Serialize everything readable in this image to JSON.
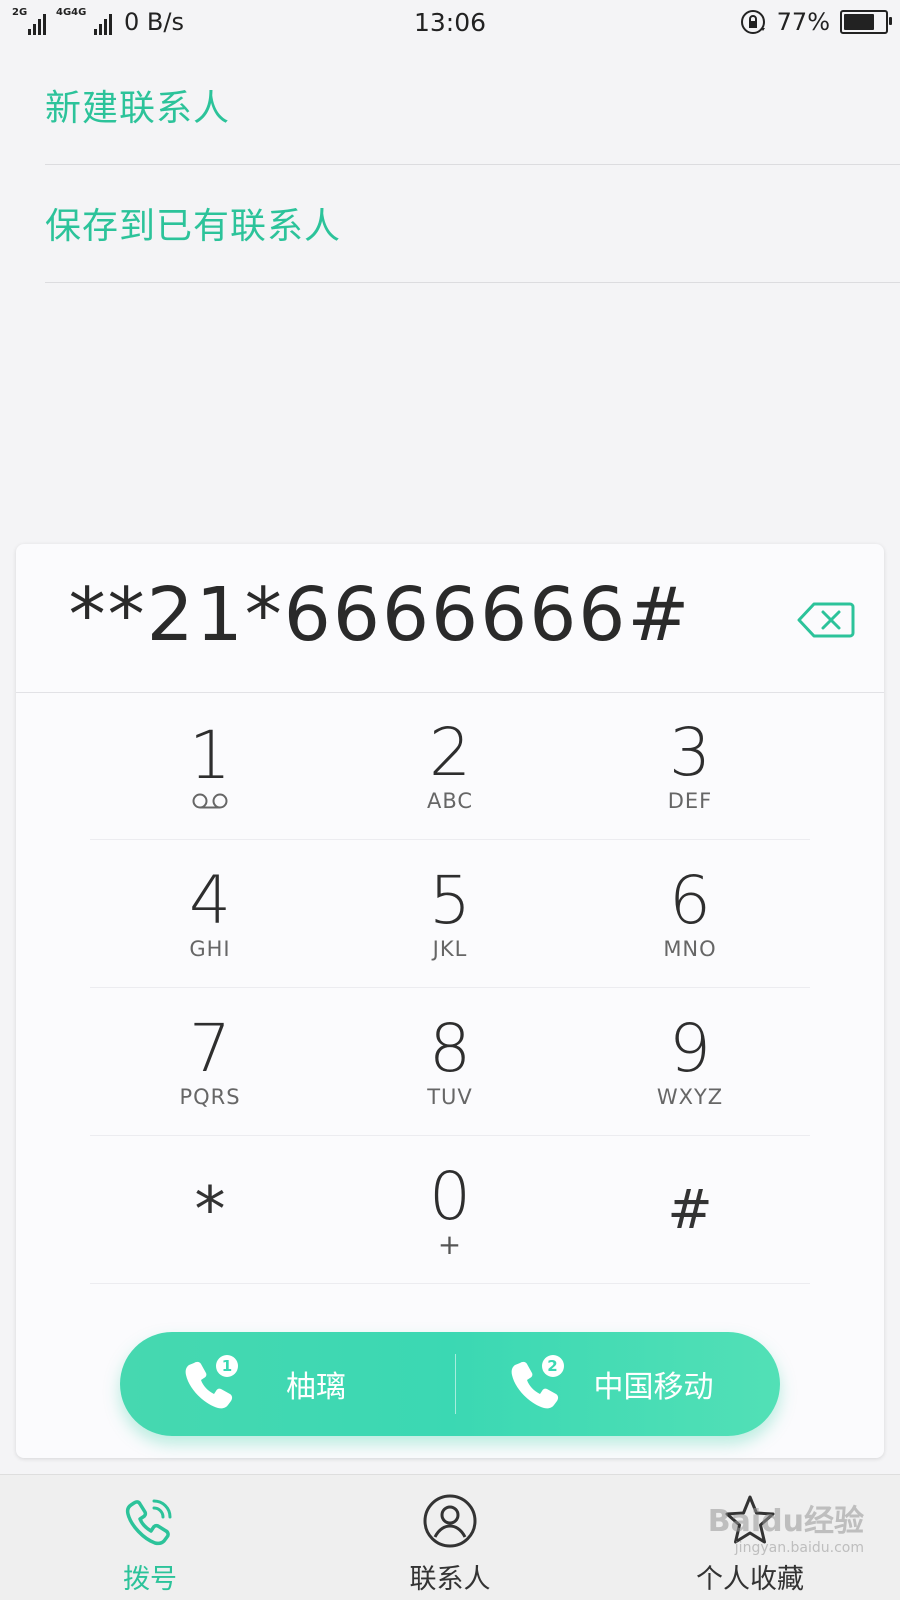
{
  "status_bar": {
    "sim1_type": "2G",
    "sim2_type": "4G",
    "sim3_type": "4G",
    "net_speed": "0 B/s",
    "time": "13:06",
    "battery_percent": "77%",
    "battery_level": 0.77
  },
  "options": {
    "new_contact": "新建联系人",
    "save_existing": "保存到已有联系人"
  },
  "dialer": {
    "number": "**21*6666666#",
    "keys": [
      [
        {
          "digit": "1",
          "letters": ""
        },
        {
          "digit": "2",
          "letters": "ABC"
        },
        {
          "digit": "3",
          "letters": "DEF"
        }
      ],
      [
        {
          "digit": "4",
          "letters": "GHI"
        },
        {
          "digit": "5",
          "letters": "JKL"
        },
        {
          "digit": "6",
          "letters": "MNO"
        }
      ],
      [
        {
          "digit": "7",
          "letters": "PQRS"
        },
        {
          "digit": "8",
          "letters": "TUV"
        },
        {
          "digit": "9",
          "letters": "WXYZ"
        }
      ],
      [
        {
          "digit": "*",
          "letters": ""
        },
        {
          "digit": "0",
          "letters": "+"
        },
        {
          "digit": "#",
          "letters": ""
        }
      ]
    ],
    "call_sim1": {
      "label": "柚璃",
      "badge": "1"
    },
    "call_sim2": {
      "label": "中国移动",
      "badge": "2"
    }
  },
  "tabs": {
    "dial": "拨号",
    "contacts": "联系人",
    "favorites": "个人收藏"
  },
  "watermark": {
    "brand": "Baidu经验",
    "url": "jingyan.baidu.com"
  },
  "colors": {
    "accent": "#2cc39a",
    "call_bar": "#3bd8b3"
  }
}
